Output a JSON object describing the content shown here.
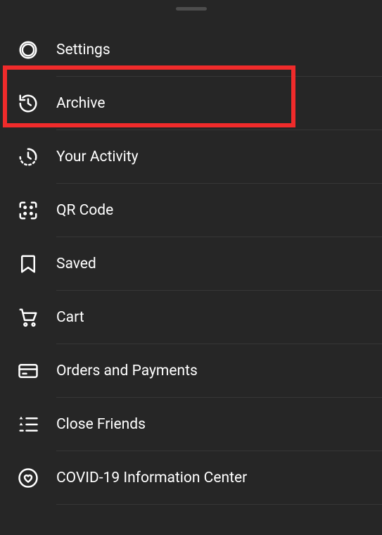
{
  "menu": {
    "items": [
      {
        "label": "Settings"
      },
      {
        "label": "Archive"
      },
      {
        "label": "Your Activity"
      },
      {
        "label": "QR Code"
      },
      {
        "label": "Saved"
      },
      {
        "label": "Cart"
      },
      {
        "label": "Orders and Payments"
      },
      {
        "label": "Close Friends"
      },
      {
        "label": "COVID-19 Information Center"
      }
    ]
  },
  "highlight_color": "#f02b2b"
}
